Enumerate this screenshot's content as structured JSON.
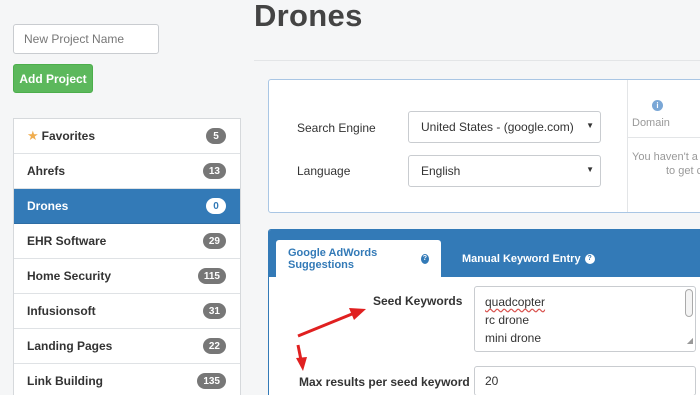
{
  "sidebar": {
    "new_project_placeholder": "New Project Name",
    "add_project_label": "Add Project",
    "projects": [
      {
        "name": "Favorites",
        "count": "5",
        "starred": true
      },
      {
        "name": "Ahrefs",
        "count": "13"
      },
      {
        "name": "Drones",
        "count": "0",
        "active": true
      },
      {
        "name": "EHR Software",
        "count": "29"
      },
      {
        "name": "Home Security",
        "count": "115"
      },
      {
        "name": "Infusionsoft",
        "count": "31"
      },
      {
        "name": "Landing Pages",
        "count": "22"
      },
      {
        "name": "Link Building",
        "count": "135"
      }
    ]
  },
  "header": {
    "title": "Drones"
  },
  "settings": {
    "search_engine_label": "Search Engine",
    "search_engine_value": "United States - (google.com)",
    "language_label": "Language",
    "language_value": "English",
    "domain_label": "Domain",
    "domain_message_1": "You haven't a",
    "domain_message_2": "to get c"
  },
  "keywords": {
    "tabs": [
      "Google AdWords Suggestions",
      "Manual Keyword Entry"
    ],
    "seed_label": "Seed Keywords",
    "seed_values": [
      "quadcopter",
      "rc drone",
      "mini drone"
    ],
    "max_results_label": "Max results per seed keyword",
    "max_results_value": "20"
  },
  "colors": {
    "primary": "#337ab7",
    "success": "#5cb85c",
    "annotation": "#e02020"
  }
}
